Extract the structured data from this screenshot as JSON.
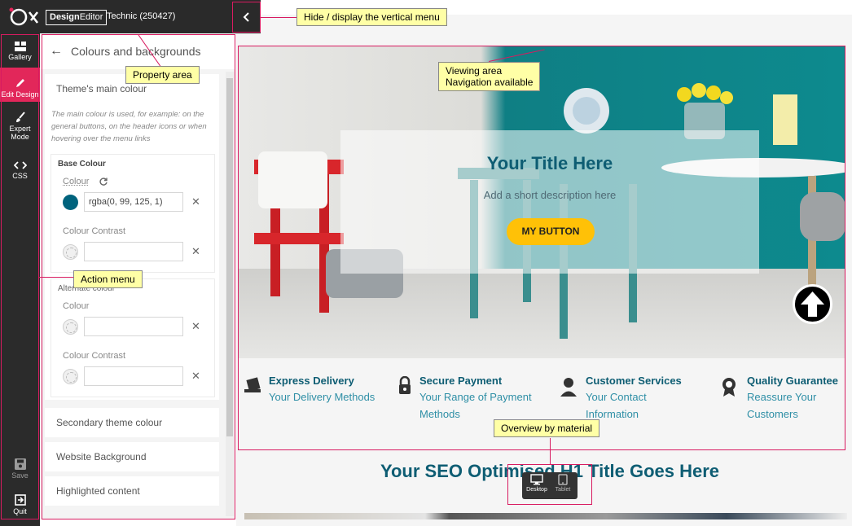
{
  "header": {
    "brand": "DesignEditor",
    "brand_bold": "Design",
    "brand_light": "Editor",
    "site_name": "Technic (250427)"
  },
  "leftnav": {
    "items": [
      {
        "label": "Gallery",
        "icon": "gallery-icon"
      },
      {
        "label": "Edit Design",
        "icon": "pencil-icon",
        "active": true
      },
      {
        "label": "Expert Mode",
        "line1": "Expert",
        "line2": "Mode",
        "icon": "brush-icon"
      },
      {
        "label": "CSS",
        "icon": "code-icon"
      }
    ],
    "bottom": [
      {
        "label": "Save",
        "icon": "save-icon"
      },
      {
        "label": "Quit",
        "icon": "quit-icon"
      }
    ]
  },
  "panel": {
    "title": "Colours and backgrounds",
    "main_colour": {
      "title": "Theme's main colour",
      "hint": "The main colour is used, for example: on the general buttons, on the header icons or when hovering over the menu links",
      "base": {
        "title": "Base Colour",
        "colour_label": "Colour",
        "colour_value": "rgba(0, 99, 125, 1)",
        "colour_swatch": "#00637d",
        "contrast_label": "Colour Contrast",
        "contrast_value": ""
      },
      "alternate": {
        "title": "Alternate colour",
        "colour_label": "Colour",
        "colour_value": "",
        "contrast_label": "Colour Contrast",
        "contrast_value": ""
      }
    },
    "sections": [
      "Secondary theme colour",
      "Website Background",
      "Highlighted content"
    ]
  },
  "preview": {
    "hero_title": "Your Title Here",
    "hero_desc": "Add a short description here",
    "hero_button": "MY BUTTON",
    "features": [
      {
        "title": "Express Delivery",
        "line1": "Your Delivery Methods",
        "line2": "",
        "icon": "delivery-icon"
      },
      {
        "title": "Secure Payment",
        "line1": "Your Range of Payment",
        "line2": "Methods",
        "icon": "lock-icon"
      },
      {
        "title": "Customer Services",
        "line1": "Your Contact",
        "line2": "Information",
        "icon": "customer-service-icon"
      },
      {
        "title": "Quality Guarantee",
        "line1": "Reassure Your",
        "line2": "Customers",
        "icon": "award-icon"
      }
    ],
    "seo_title": "Your SEO Optimised H1 Title Goes Here",
    "devices": [
      "Desktop",
      "Tablet"
    ]
  },
  "callouts": {
    "toggle": "Hide / display the vertical menu",
    "property": "Property area",
    "viewing_line1": "Viewing area",
    "viewing_line2": "Navigation available",
    "action": "Action menu",
    "overview": "Overview by material"
  },
  "colors": {
    "accent": "#d81b60",
    "active_nav": "#e2275a",
    "primary": "#0e5d73",
    "button": "#ffc107",
    "callout": "#ffffa6"
  }
}
